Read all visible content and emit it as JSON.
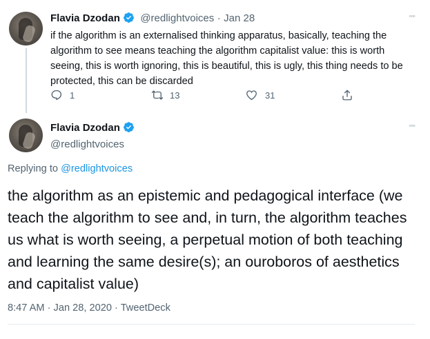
{
  "tweet1": {
    "name": "Flavia Dzodan",
    "handle": "@redlightvoices",
    "separator": "·",
    "date": "Jan 28",
    "more": "◦◦◦",
    "text": "if the algorithm is an externalised thinking apparatus, basically, teaching the algorithm to see means teaching the algorithm capitalist value: this is worth seeing, this is worth ignoring, this is beautiful, this is ugly, this thing needs to be protected, this can be discarded",
    "replies": "1",
    "retweets": "13",
    "likes": "31"
  },
  "tweet2": {
    "name": "Flavia Dzodan",
    "handle": "@redlightvoices",
    "more": "◦◦◦",
    "replying_prefix": "Replying to",
    "replying_handle": "@redlightvoices",
    "text": "the algorithm as an epistemic and pedagogical interface (we teach the algorithm to see and, in turn, the algorithm teaches us what is worth seeing, a perpetual motion of both teaching and learning the same desire(s); an ouroboros of aesthetics and capitalist value)",
    "time": "8:47 AM",
    "date": "Jan 28, 2020",
    "source": "TweetDeck"
  },
  "colors": {
    "verified": "#1da1f2",
    "link": "#1b95e0",
    "muted": "#536471"
  }
}
